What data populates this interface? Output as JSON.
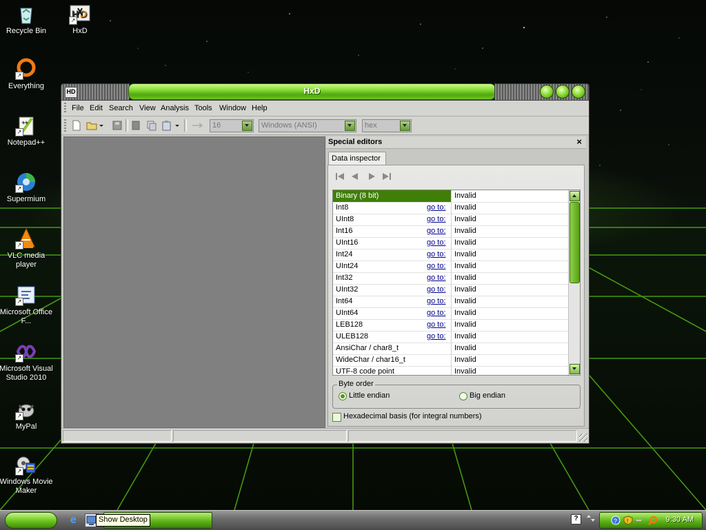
{
  "desktop": {
    "icons": [
      {
        "label": "Recycle Bin",
        "icon": "recycle-bin-icon"
      },
      {
        "label": "HxD",
        "icon": "hxd-icon"
      },
      {
        "label": "Everything",
        "icon": "everything-icon"
      },
      {
        "label": "Notepad++",
        "icon": "notepadpp-icon"
      },
      {
        "label": "Supermium",
        "icon": "supermium-icon"
      },
      {
        "label": "VLC media player",
        "icon": "vlc-icon"
      },
      {
        "label": "Microsoft Office F...",
        "icon": "office-icon"
      },
      {
        "label": "Microsoft Visual Studio 2010",
        "icon": "visual-studio-icon"
      },
      {
        "label": "MyPal",
        "icon": "mypal-icon"
      },
      {
        "label": "Windows Movie Maker",
        "icon": "movie-maker-icon"
      }
    ]
  },
  "window": {
    "title": "HxD",
    "menu": [
      "File",
      "Edit",
      "Search",
      "View",
      "Analysis",
      "Tools",
      "Window",
      "Help"
    ],
    "toolbar": {
      "bytes_per_row": "16",
      "charset": "Windows (ANSI)",
      "base": "hex"
    }
  },
  "special_editors": {
    "title": "Special editors",
    "close": "×",
    "tab": "Data inspector",
    "goto_label": "go to:",
    "rows": [
      {
        "name": "Binary (8 bit)",
        "goto": false,
        "value": "Invalid"
      },
      {
        "name": "Int8",
        "goto": true,
        "value": "Invalid"
      },
      {
        "name": "UInt8",
        "goto": true,
        "value": "Invalid"
      },
      {
        "name": "Int16",
        "goto": true,
        "value": "Invalid"
      },
      {
        "name": "UInt16",
        "goto": true,
        "value": "Invalid"
      },
      {
        "name": "Int24",
        "goto": true,
        "value": "Invalid"
      },
      {
        "name": "UInt24",
        "goto": true,
        "value": "Invalid"
      },
      {
        "name": "Int32",
        "goto": true,
        "value": "Invalid"
      },
      {
        "name": "UInt32",
        "goto": true,
        "value": "Invalid"
      },
      {
        "name": "Int64",
        "goto": true,
        "value": "Invalid"
      },
      {
        "name": "UInt64",
        "goto": true,
        "value": "Invalid"
      },
      {
        "name": "LEB128",
        "goto": true,
        "value": "Invalid"
      },
      {
        "name": "ULEB128",
        "goto": true,
        "value": "Invalid"
      },
      {
        "name": "AnsiChar / char8_t",
        "goto": false,
        "value": "Invalid"
      },
      {
        "name": "WideChar / char16_t",
        "goto": false,
        "value": "Invalid"
      },
      {
        "name": "UTF-8 code point",
        "goto": false,
        "value": "Invalid"
      }
    ],
    "byte_order": {
      "legend": "Byte order",
      "little": "Little endian",
      "big": "Big endian",
      "selected": "little"
    },
    "hex_basis_label": "Hexadecimal basis (for integral numbers)"
  },
  "taskbar": {
    "tooltip": "Show Desktop",
    "clock": "9:30 AM"
  },
  "colors": {
    "accent_green": "#5fb418",
    "selection": "#3f7f08"
  }
}
